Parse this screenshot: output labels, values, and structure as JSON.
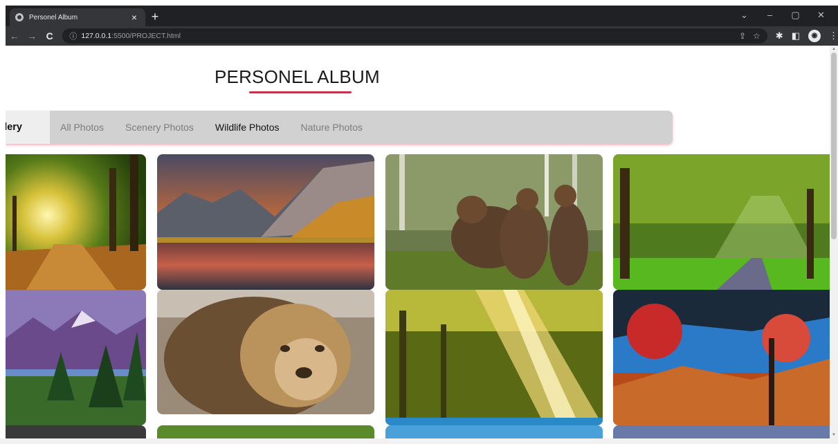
{
  "browser": {
    "tab_title": "Personel Album",
    "tab_close": "×",
    "new_tab": "+",
    "url_host": "127.0.0.1",
    "url_path": ":5500/PROJECT.html",
    "back": "←",
    "forward": "→",
    "reload": "C",
    "window_controls": [
      "⌄",
      "–",
      "▢",
      "✕"
    ]
  },
  "page": {
    "title": "PERSONEL ALBUM",
    "accent_color": "#c8324a"
  },
  "filterbar": {
    "brand": "Gallery",
    "items": [
      {
        "label": "All Photos",
        "active": false
      },
      {
        "label": "Scenery Photos",
        "active": false
      },
      {
        "label": "Wildlife Photos",
        "active": true
      },
      {
        "label": "Nature Photos",
        "active": false
      }
    ]
  },
  "gallery": [
    {
      "subject": "forest-road-sunset"
    },
    {
      "subject": "mountain-lake-sunset"
    },
    {
      "subject": "bears"
    },
    {
      "subject": "forest-path-sunrays"
    },
    {
      "subject": "purple-mountains"
    },
    {
      "subject": "lion"
    },
    {
      "subject": "sunlit-jungle"
    },
    {
      "subject": "autumn-tree-valley"
    },
    {
      "subject": "partial-photo-1"
    },
    {
      "subject": "partial-photo-2"
    },
    {
      "subject": "partial-photo-3"
    },
    {
      "subject": "partial-photo-4"
    }
  ]
}
